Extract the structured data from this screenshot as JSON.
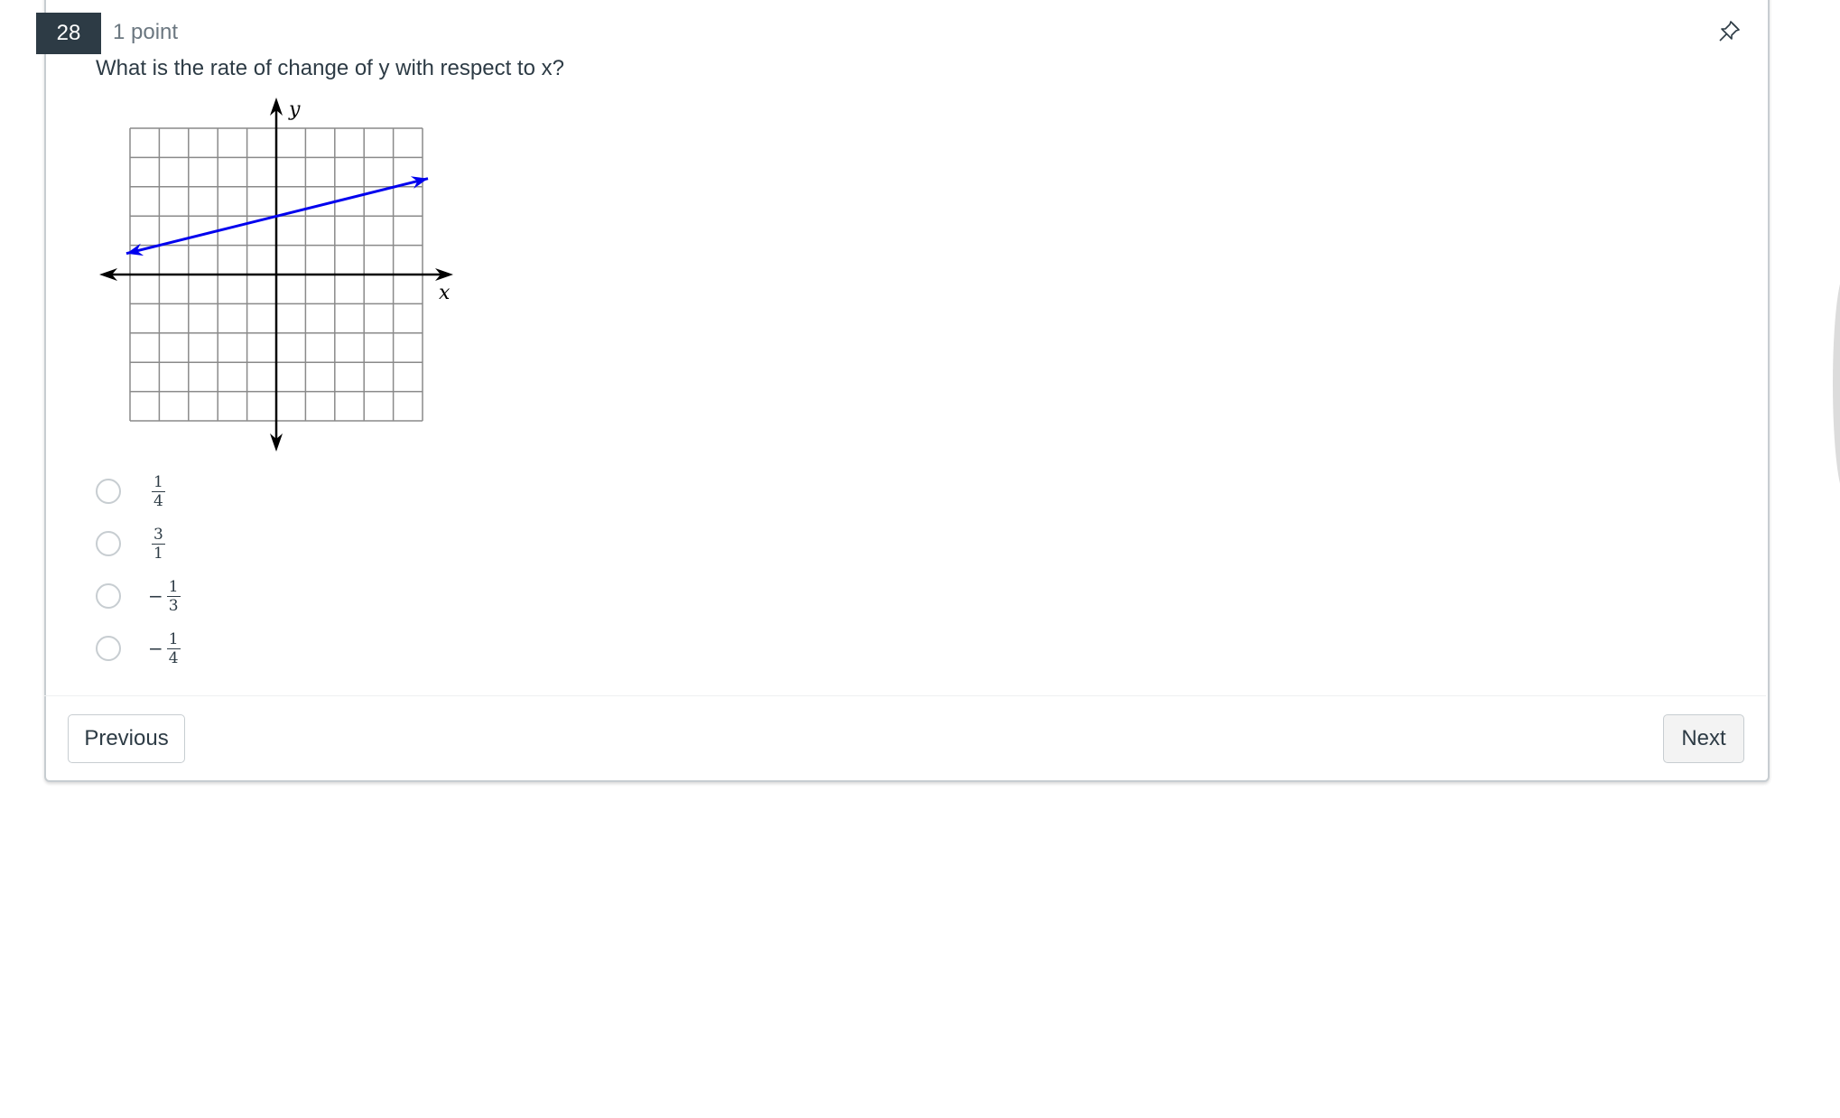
{
  "question": {
    "number": "28",
    "points": "1 point",
    "text": "What is the rate of change of y with respect to x?",
    "pin_icon": "pushpin-icon"
  },
  "graph": {
    "x_axis_label": "x",
    "y_axis_label": "y",
    "x_range": [
      -5,
      5
    ],
    "y_range": [
      -5,
      5
    ],
    "grid_step": 1,
    "line_color": "#0000ee",
    "line": {
      "description": "line with arrowheads at both ends",
      "points": [
        [
          -5,
          0.75
        ],
        [
          5,
          3.25
        ]
      ],
      "y_intercept": 2,
      "slope": 0.25
    }
  },
  "answers": [
    {
      "sign": "",
      "numerator": "1",
      "denominator": "4",
      "selected": false
    },
    {
      "sign": "",
      "numerator": "3",
      "denominator": "1",
      "selected": false
    },
    {
      "sign": "−",
      "numerator": "1",
      "denominator": "3",
      "selected": false
    },
    {
      "sign": "−",
      "numerator": "1",
      "denominator": "4",
      "selected": false
    }
  ],
  "footer": {
    "previous_label": "Previous",
    "next_label": "Next"
  }
}
